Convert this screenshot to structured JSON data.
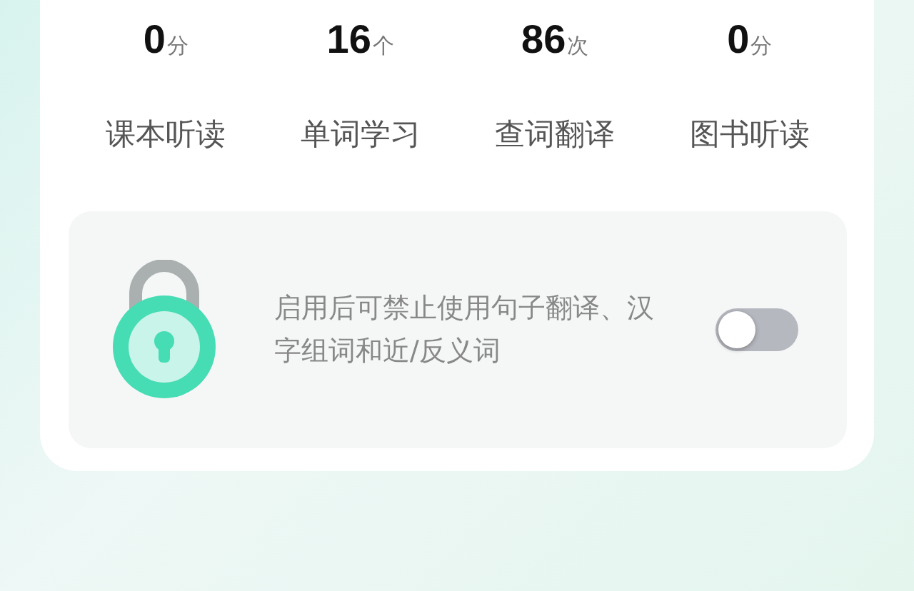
{
  "stats": [
    {
      "value": "0",
      "unit": "分",
      "label": "课本听读"
    },
    {
      "value": "16",
      "unit": "个",
      "label": "单词学习"
    },
    {
      "value": "86",
      "unit": "次",
      "label": "查词翻译"
    },
    {
      "value": "0",
      "unit": "分",
      "label": "图书听读"
    }
  ],
  "lock_panel": {
    "description": "启用后可禁止使用句子翻译、汉字组词和近/反义词",
    "toggle_on": false
  }
}
